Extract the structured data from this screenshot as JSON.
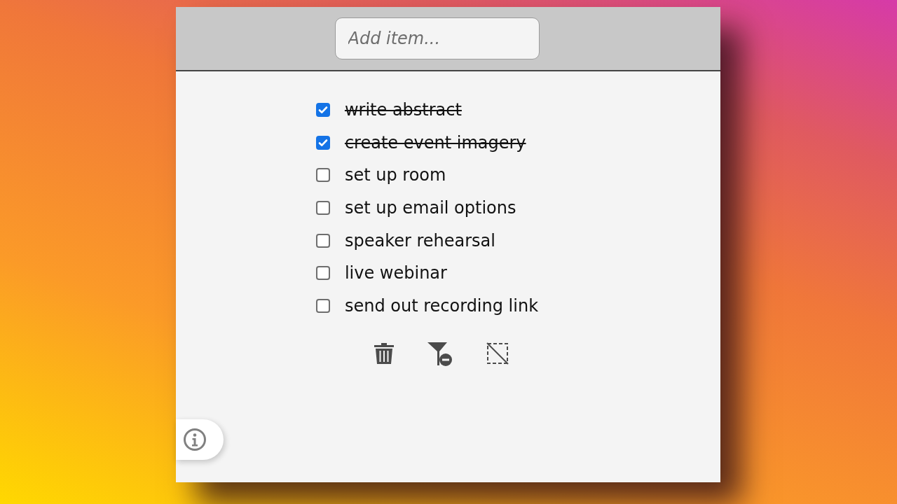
{
  "add_item": {
    "placeholder": "Add item..."
  },
  "items": [
    {
      "label": "write abstract",
      "checked": true
    },
    {
      "label": "create event imagery",
      "checked": true
    },
    {
      "label": "set up room",
      "checked": false
    },
    {
      "label": "set up email options",
      "checked": false
    },
    {
      "label": "speaker rehearsal",
      "checked": false
    },
    {
      "label": "live webinar",
      "checked": false
    },
    {
      "label": "send out recording link",
      "checked": false
    }
  ],
  "toolbar": [
    {
      "kind": "delete"
    },
    {
      "kind": "filter"
    },
    {
      "kind": "deselect"
    }
  ]
}
